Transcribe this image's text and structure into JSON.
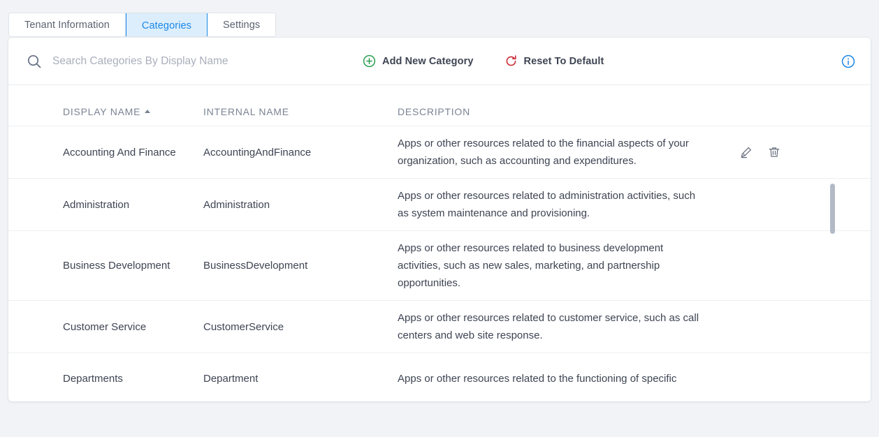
{
  "tabs": [
    {
      "label": "Tenant Information",
      "active": false
    },
    {
      "label": "Categories",
      "active": true
    },
    {
      "label": "Settings",
      "active": false
    }
  ],
  "toolbar": {
    "search_placeholder": "Search Categories By Display Name",
    "search_value": "",
    "add_label": "Add New Category",
    "reset_label": "Reset To Default",
    "add_icon_color": "#2e9e52",
    "reset_icon_color": "#cc2936",
    "info_icon_color": "#1b87e6"
  },
  "table": {
    "columns": [
      {
        "label": "DISPLAY NAME",
        "sorted": "asc"
      },
      {
        "label": "INTERNAL NAME",
        "sorted": ""
      },
      {
        "label": "DESCRIPTION",
        "sorted": ""
      }
    ],
    "rows": [
      {
        "display_name": "Accounting And Finance",
        "internal_name": "AccountingAndFinance",
        "description": "Apps or other resources related to the financial aspects of your organization, such as accounting and expenditures."
      },
      {
        "display_name": "Administration",
        "internal_name": "Administration",
        "description": "Apps or other resources related to administration activities, such as system maintenance and provisioning."
      },
      {
        "display_name": "Business Development",
        "internal_name": "BusinessDevelopment",
        "description": "Apps or other resources related to business development activities, such as new sales, marketing, and partnership opportunities."
      },
      {
        "display_name": "Customer Service",
        "internal_name": "CustomerService",
        "description": "Apps or other resources related to customer service, such as call centers and web site response."
      },
      {
        "display_name": "Departments",
        "internal_name": "Department",
        "description": "Apps or other resources related to the functioning of specific"
      }
    ],
    "row_actions": {
      "edit_label": "Edit",
      "delete_label": "Delete"
    }
  }
}
